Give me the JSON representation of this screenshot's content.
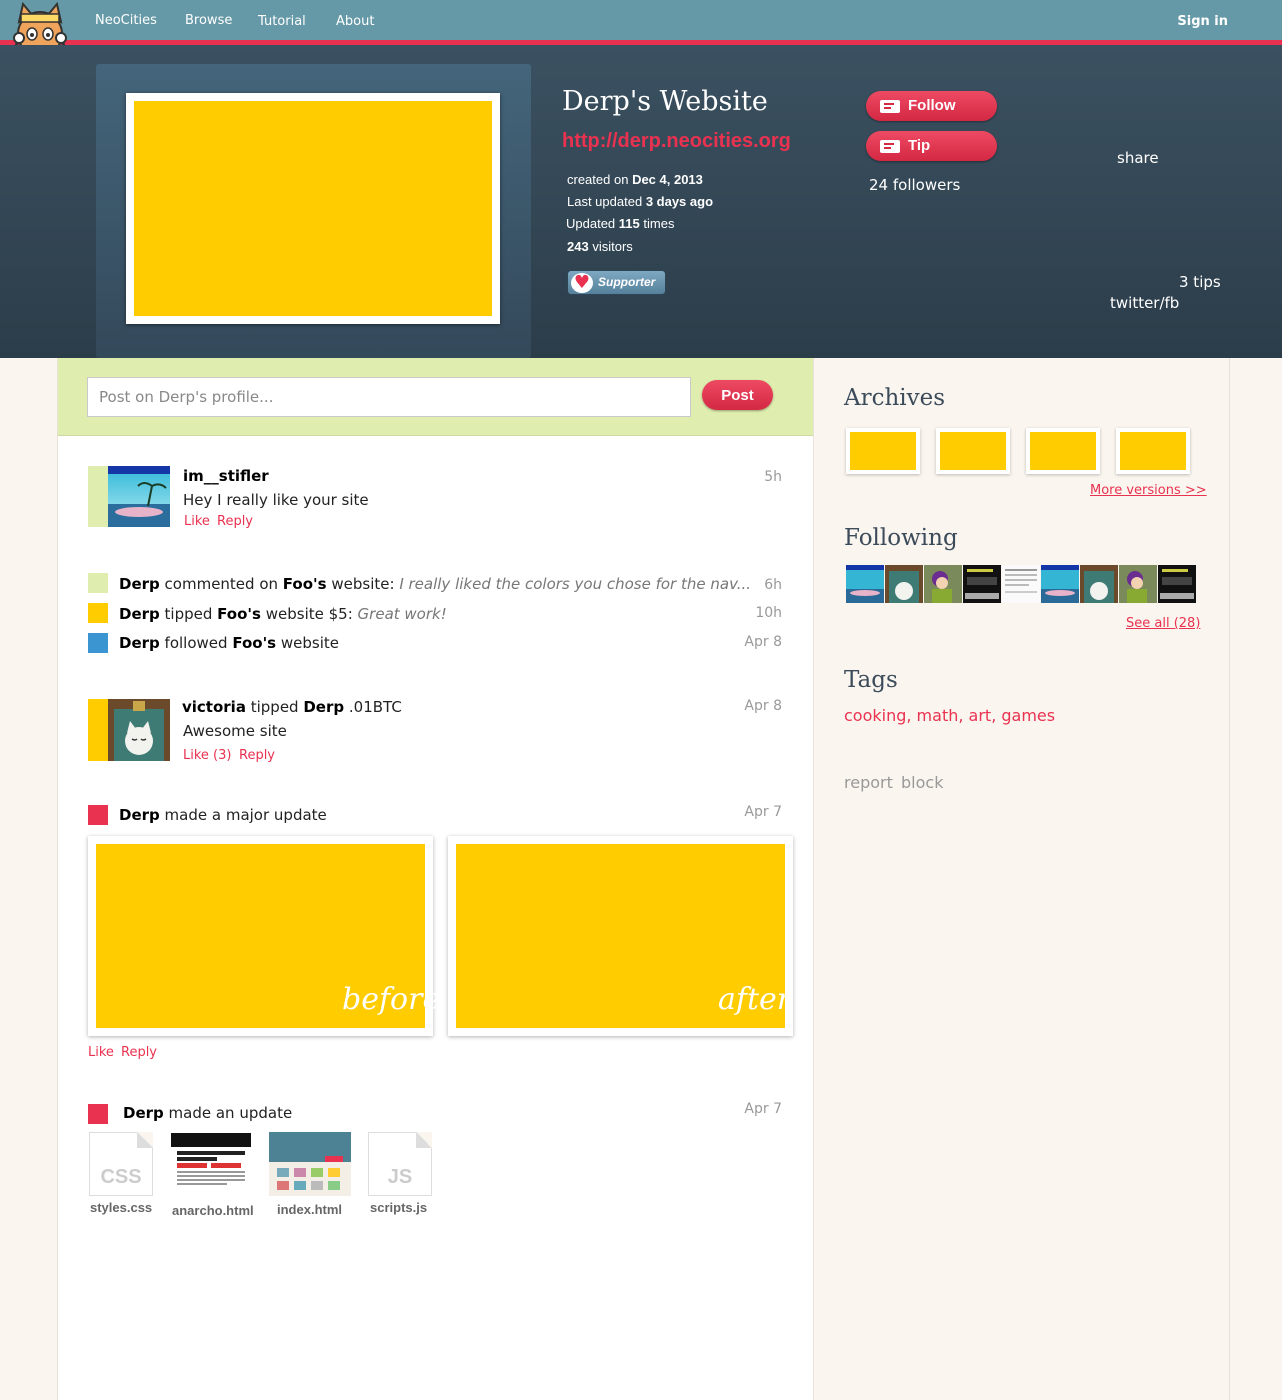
{
  "nav": {
    "brand": "NeoCities",
    "links": [
      "Browse",
      "Tutorial",
      "About"
    ],
    "signin": "Sign in"
  },
  "site": {
    "title": "Derp's Website",
    "url": "http://derp.neocities.org",
    "stats": [
      {
        "label": "created on",
        "value": "Dec 4, 2013",
        "value_first": false
      },
      {
        "label": "Last updated",
        "value": "3 days ago",
        "value_first": false
      },
      {
        "label": "Updated",
        "value": "115",
        "suffix": "times"
      },
      {
        "label": "visitors",
        "value": "243",
        "value_first": true
      }
    ],
    "badge": "Supporter"
  },
  "actions": {
    "follow": "Follow",
    "tip": "Tip",
    "followers": "24 followers",
    "share": "share",
    "tips": "3 tips",
    "social": "twitter/fb"
  },
  "post": {
    "placeholder": "Post on Derp's profile...",
    "button": "Post"
  },
  "feed": {
    "comment1": {
      "user": "im__stifler",
      "text": "Hey I really like your site",
      "time": "5h",
      "like": "Like",
      "reply": "Reply"
    },
    "event1": {
      "actor": "Derp",
      "verb": "commented on",
      "target": "Foo's",
      "rest": "website:",
      "quote": "I really liked the colors you chose for the nav...",
      "time": "6h",
      "color": "#dfedae"
    },
    "event2": {
      "actor": "Derp",
      "verb": "tipped",
      "target": "Foo's",
      "rest": "website $5:",
      "quote": "Great work!",
      "time": "10h",
      "color": "#ffcc00"
    },
    "event3": {
      "actor": "Derp",
      "verb": "followed",
      "target": "Foo's",
      "rest": "website",
      "time": "Apr 8",
      "color": "#3b95d0"
    },
    "tip": {
      "actor": "victoria",
      "verb": "tipped",
      "target": "Derp",
      "amount": ".01BTC",
      "text": "Awesome site",
      "time": "Apr 8",
      "like": "Like (3)",
      "reply": "Reply",
      "color": "#ffcc00"
    },
    "major_update": {
      "actor": "Derp",
      "text": "made a major update",
      "time": "Apr 7",
      "before": "before",
      "after": "after",
      "like": "Like",
      "reply": "Reply",
      "color": "#e93250"
    },
    "update": {
      "actor": "Derp",
      "text": "made an update",
      "time": "Apr 7",
      "color": "#e93250",
      "files": [
        {
          "name": "styles.css",
          "ext": "CSS"
        },
        {
          "name": "anarcho.html",
          "ext": ""
        },
        {
          "name": "index.html",
          "ext": ""
        },
        {
          "name": "scripts.js",
          "ext": "JS"
        }
      ]
    }
  },
  "sidebar": {
    "archives_title": "Archives",
    "more_versions": "More versions >>",
    "following_title": "Following",
    "see_all": "See all (28)",
    "tags_title": "Tags",
    "tags": "cooking, math, art, games",
    "report": "report",
    "block": "block"
  },
  "colors": {
    "accent": "#e93250",
    "topbar": "#6699a7",
    "header": "#2f4250",
    "placeholder_yellow": "#ffcc00",
    "post_bar": "#dfedae"
  }
}
